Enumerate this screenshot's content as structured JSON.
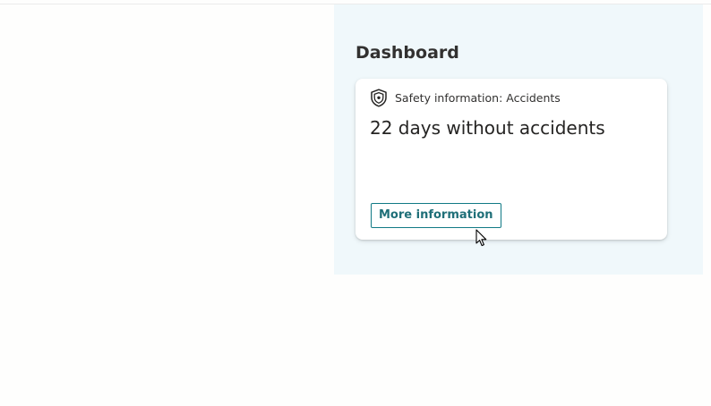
{
  "dashboard": {
    "title": "Dashboard",
    "card": {
      "icon": "shield-icon",
      "category": "Safety information: Accidents",
      "headline": "22 days without accidents",
      "button_label": "More information"
    }
  },
  "colors": {
    "panel_background": "#f0f8fb",
    "button_accent": "#117a85",
    "page_background": "#fefefd"
  }
}
